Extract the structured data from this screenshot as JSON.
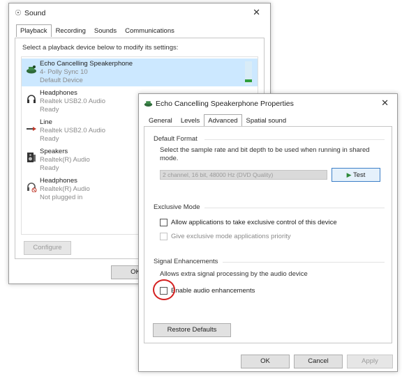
{
  "sound_window": {
    "title": "Sound",
    "tabs": [
      {
        "label": "Playback",
        "active": true
      },
      {
        "label": "Recording",
        "active": false
      },
      {
        "label": "Sounds",
        "active": false
      },
      {
        "label": "Communications",
        "active": false
      }
    ],
    "instruction": "Select a playback device below to modify its settings:",
    "devices": [
      {
        "name": "Echo Cancelling Speakerphone",
        "detail": "4- Polly Sync 10",
        "status": "Default Device",
        "selected": true,
        "icon": "speakerphone-icon"
      },
      {
        "name": "Headphones",
        "detail": "Realtek USB2.0 Audio",
        "status": "Ready",
        "selected": false,
        "icon": "headphones-icon"
      },
      {
        "name": "Line",
        "detail": "Realtek USB2.0 Audio",
        "status": "Ready",
        "selected": false,
        "icon": "line-out-icon"
      },
      {
        "name": "Speakers",
        "detail": "Realtek(R) Audio",
        "status": "Ready",
        "selected": false,
        "icon": "speakers-icon"
      },
      {
        "name": "Headphones",
        "detail": "Realtek(R) Audio",
        "status": "Not plugged in",
        "selected": false,
        "icon": "headphones-unplugged-icon"
      }
    ],
    "configure_label": "Configure",
    "ok_label": "OK"
  },
  "properties_window": {
    "title": "Echo Cancelling Speakerphone Properties",
    "tabs": [
      {
        "label": "General",
        "active": false
      },
      {
        "label": "Levels",
        "active": false
      },
      {
        "label": "Advanced",
        "active": true
      },
      {
        "label": "Spatial sound",
        "active": false
      }
    ],
    "default_format": {
      "title": "Default Format",
      "description": "Select the sample rate and bit depth to be used when running in shared mode.",
      "selected_format": "2 channel, 16 bit, 48000 Hz (DVD Quality)",
      "test_label": "Test"
    },
    "exclusive_mode": {
      "title": "Exclusive Mode",
      "allow_exclusive_label": "Allow applications to take exclusive control of this device",
      "priority_label": "Give exclusive mode applications priority"
    },
    "signal_enhancements": {
      "title": "Signal Enhancements",
      "description": "Allows extra signal processing by the audio device",
      "enable_label": "Enable audio enhancements"
    },
    "restore_defaults_label": "Restore Defaults",
    "ok_label": "OK",
    "cancel_label": "Cancel",
    "apply_label": "Apply"
  },
  "colors": {
    "selection": "#cce8ff",
    "meter_green": "#2e9e3c",
    "highlight_circle": "#d42020",
    "test_play": "#2e8a3a"
  }
}
